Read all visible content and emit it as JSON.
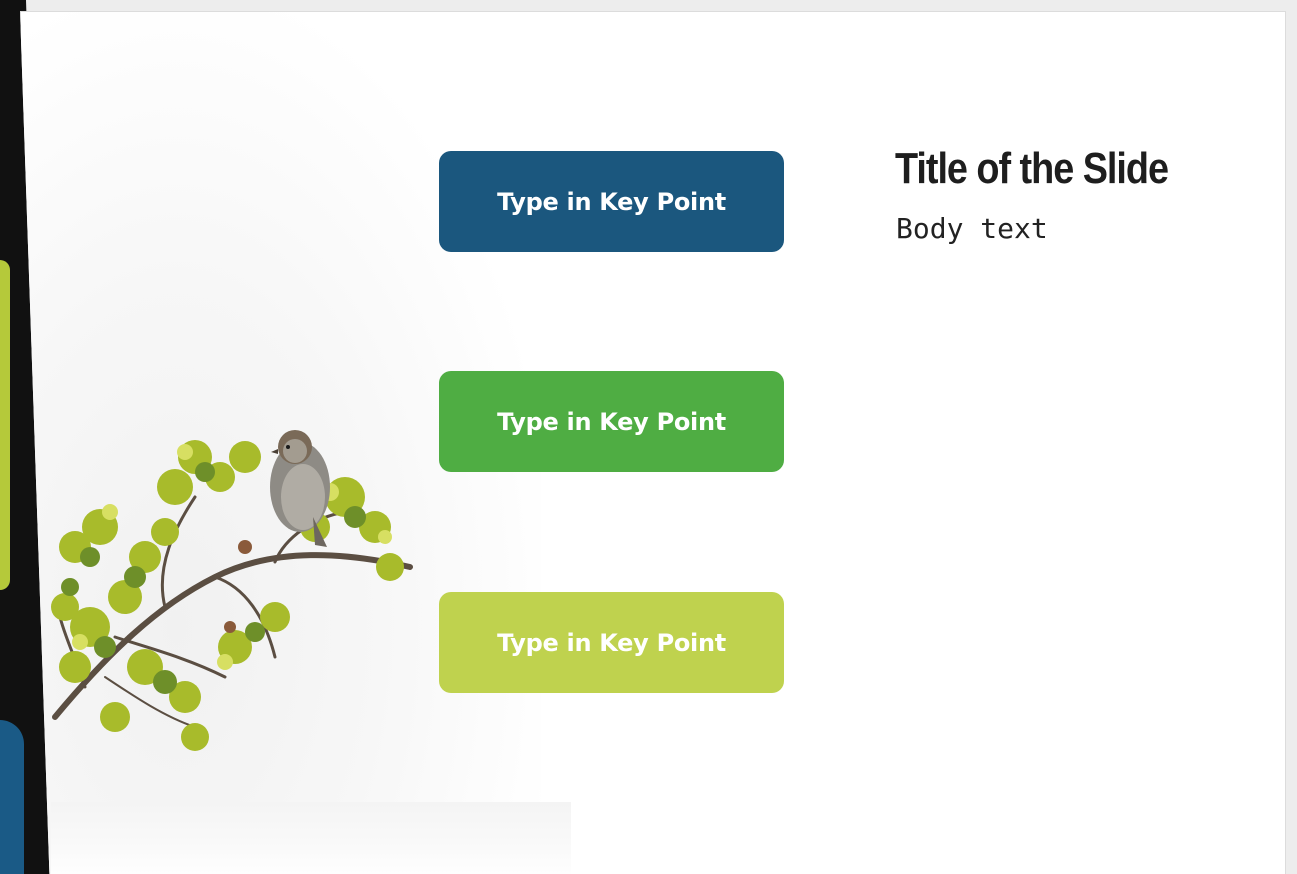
{
  "slide": {
    "title": "Title of the Slide",
    "body": "Body text",
    "key_points": [
      {
        "label": "Type in Key Point",
        "color": "#1b577e"
      },
      {
        "label": "Type in Key Point",
        "color": "#4fad43"
      },
      {
        "label": "Type in Key Point",
        "color": "#bfd24e"
      }
    ],
    "image": {
      "icon": "bird-on-branch-photo"
    }
  },
  "colors": {
    "title": "#1e1e1e",
    "background": "#ffffff",
    "sliver_dark": "#111111",
    "sliver_lime": "#b5c93a",
    "sliver_blue": "#1a5a86"
  }
}
